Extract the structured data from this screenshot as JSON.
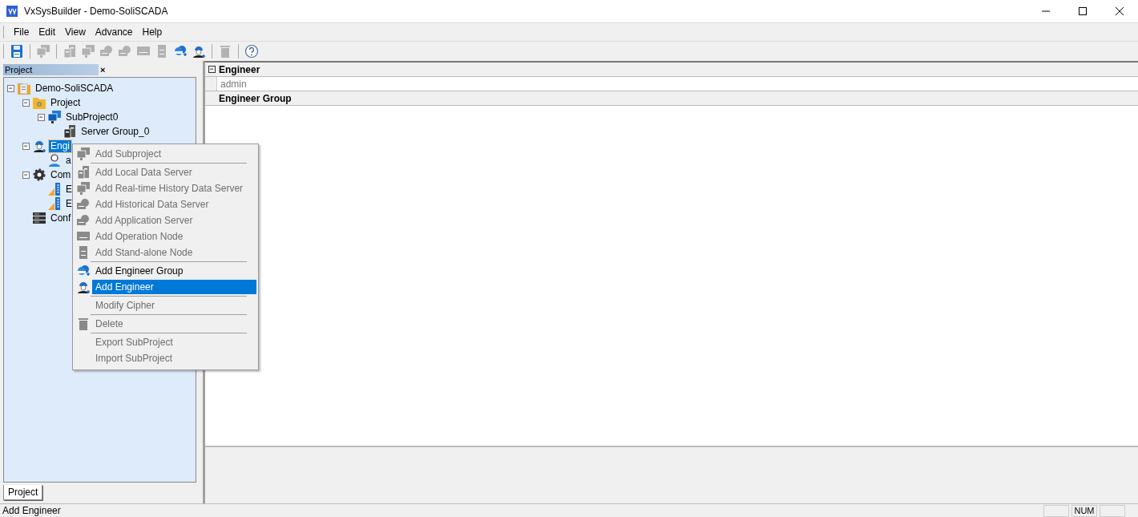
{
  "window": {
    "title": "VxSysBuilder - Demo-SoliSCADA"
  },
  "menu_bar": [
    "File",
    "Edit",
    "View",
    "Advance",
    "Help"
  ],
  "toolbar": [
    {
      "kind": "save",
      "disabled": false
    },
    {
      "kind": "separator"
    },
    {
      "kind": "monitors",
      "disabled": true
    },
    {
      "kind": "separator"
    },
    {
      "kind": "server",
      "disabled": true
    },
    {
      "kind": "monitors",
      "disabled": true
    },
    {
      "kind": "cloud",
      "disabled": true
    },
    {
      "kind": "cloud",
      "disabled": true
    },
    {
      "kind": "node",
      "disabled": true
    },
    {
      "kind": "tower",
      "disabled": true
    },
    {
      "kind": "group",
      "disabled": false
    },
    {
      "kind": "engineer",
      "disabled": false
    },
    {
      "kind": "separator"
    },
    {
      "kind": "trash",
      "disabled": true
    },
    {
      "kind": "separator"
    },
    {
      "kind": "help",
      "disabled": false
    }
  ],
  "project_panel": {
    "title": "Project",
    "close": "×",
    "tab": "Project",
    "tree": [
      {
        "label": "Demo-SoliSCADA",
        "kind": "project",
        "expanded": true,
        "selected": false,
        "children": [
          {
            "label": "Project",
            "kind": "folder",
            "expanded": true,
            "selected": false,
            "children": [
              {
                "label": "SubProject0",
                "kind": "monitors",
                "expanded": true,
                "selected": false,
                "children": [
                  {
                    "label": "Server Group_0",
                    "kind": "server",
                    "selected": false
                  }
                ]
              }
            ]
          },
          {
            "label": "Engi",
            "kind": "engineer",
            "expanded": true,
            "selected": true,
            "children": [
              {
                "label": "a",
                "kind": "person",
                "selected": false
              }
            ]
          },
          {
            "label": "Com",
            "kind": "gear",
            "expanded": true,
            "selected": false,
            "children": [
              {
                "label": "E",
                "kind": "ruler",
                "selected": false
              },
              {
                "label": "E",
                "kind": "ruler",
                "selected": false
              }
            ]
          },
          {
            "label": "Conf",
            "kind": "rack",
            "selected": false
          }
        ]
      }
    ]
  },
  "detail_panel": {
    "groups": [
      {
        "title": "Engineer",
        "expanded": true,
        "rows": [
          "admin"
        ]
      },
      {
        "title": "Engineer Group"
      }
    ]
  },
  "context_menu": {
    "items": [
      {
        "kind": "monitors",
        "label": "Add Subproject",
        "disabled": true,
        "selected": false
      },
      {
        "kind": "separator"
      },
      {
        "kind": "server",
        "label": "Add Local Data Server",
        "disabled": true,
        "selected": false
      },
      {
        "kind": "monitors",
        "label": "Add Real-time History Data Server",
        "disabled": true,
        "selected": false
      },
      {
        "kind": "cloud",
        "label": "Add Historical Data Server",
        "disabled": true,
        "selected": false
      },
      {
        "kind": "cloud",
        "label": "Add Application Server",
        "disabled": true,
        "selected": false
      },
      {
        "kind": "node",
        "label": "Add Operation Node",
        "disabled": true,
        "selected": false
      },
      {
        "kind": "tower",
        "label": "Add Stand-alone Node",
        "disabled": true,
        "selected": false
      },
      {
        "kind": "separator"
      },
      {
        "kind": "group",
        "label": "Add Engineer Group",
        "disabled": false,
        "selected": false
      },
      {
        "kind": "engineer",
        "label": "Add Engineer",
        "disabled": false,
        "selected": true
      },
      {
        "kind": "separator"
      },
      {
        "kind": "text",
        "label": "Modify Cipher",
        "disabled": true,
        "selected": false
      },
      {
        "kind": "separator"
      },
      {
        "kind": "trash",
        "label": "Delete",
        "disabled": true,
        "selected": false
      },
      {
        "kind": "separator"
      },
      {
        "kind": "text",
        "label": "Export SubProject",
        "disabled": true,
        "selected": false
      },
      {
        "kind": "text",
        "label": "Import SubProject",
        "disabled": true,
        "selected": false
      }
    ]
  },
  "status_bar": {
    "text": "Add Engineer",
    "indicators": [
      "NUM"
    ]
  }
}
